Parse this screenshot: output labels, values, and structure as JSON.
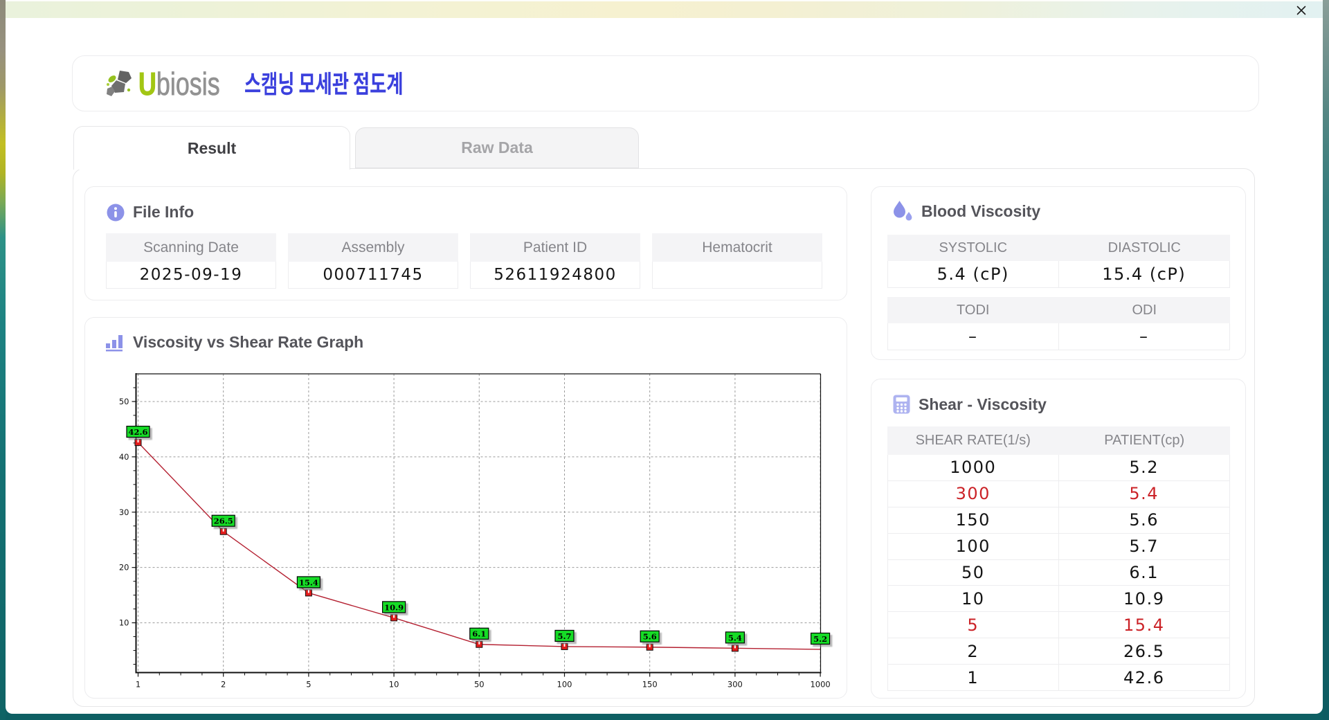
{
  "window": {
    "close_icon": "×"
  },
  "header": {
    "logo_first_letter": "U",
    "logo_rest": "biosis",
    "app_title": "스캠닝 모세관 점도계"
  },
  "tabs": {
    "result": "Result",
    "raw_data": "Raw Data"
  },
  "file_info": {
    "title": "File Info",
    "fields": [
      {
        "label": "Scanning Date",
        "value": "2025-09-19"
      },
      {
        "label": "Assembly",
        "value": "000711745"
      },
      {
        "label": "Patient ID",
        "value": "52611924800"
      },
      {
        "label": "Hematocrit",
        "value": ""
      }
    ]
  },
  "blood_viscosity": {
    "title": "Blood Viscosity",
    "groups": [
      {
        "headers": [
          "SYSTOLIC",
          "DIASTOLIC"
        ],
        "values": [
          "5.4 (cP)",
          "15.4 (cP)"
        ]
      },
      {
        "headers": [
          "TODI",
          "ODI"
        ],
        "values": [
          "–",
          "–"
        ]
      }
    ]
  },
  "shear_viscosity": {
    "title": "Shear - Viscosity",
    "columns": [
      "SHEAR RATE(1/s)",
      "PATIENT(cp)"
    ],
    "rows": [
      {
        "shear_rate": "1000",
        "patient": "5.2",
        "highlight": false
      },
      {
        "shear_rate": "300",
        "patient": "5.4",
        "highlight": true
      },
      {
        "shear_rate": "150",
        "patient": "5.6",
        "highlight": false
      },
      {
        "shear_rate": "100",
        "patient": "5.7",
        "highlight": false
      },
      {
        "shear_rate": "50",
        "patient": "6.1",
        "highlight": false
      },
      {
        "shear_rate": "10",
        "patient": "10.9",
        "highlight": false
      },
      {
        "shear_rate": "5",
        "patient": "15.4",
        "highlight": true
      },
      {
        "shear_rate": "2",
        "patient": "26.5",
        "highlight": false
      },
      {
        "shear_rate": "1",
        "patient": "42.6",
        "highlight": false
      }
    ]
  },
  "chart_data": {
    "type": "line",
    "title": "Viscosity vs Shear Rate Graph",
    "xlabel": "",
    "ylabel": "",
    "categories": [
      1,
      2,
      5,
      10,
      50,
      100,
      150,
      300,
      1000
    ],
    "series": [
      {
        "name": "Patient",
        "values": [
          42.6,
          26.5,
          15.4,
          10.9,
          6.1,
          5.7,
          5.6,
          5.4,
          5.2
        ]
      }
    ],
    "point_labels": [
      "42.6",
      "26.5",
      "15.4",
      "10.9",
      "6.1",
      "5.7",
      "5.6",
      "5.4",
      "5.2"
    ],
    "ylim": [
      1,
      55
    ],
    "yticks": [
      10,
      20,
      30,
      40,
      50
    ],
    "grid": "dashed",
    "legend": "none",
    "colors": {
      "line": "#b42031",
      "marker_fill": "#e31c1c",
      "marker_border": "#111111",
      "label_bg": "#12dc28",
      "label_border": "#000000",
      "grid": "#9b9b9b",
      "axis": "#111111"
    }
  },
  "colors": {
    "accent_indigo": "#8c92e8",
    "title_blue": "#3c41dc",
    "logo_green": "#8fc31f",
    "highlight_red": "#cb2227"
  }
}
